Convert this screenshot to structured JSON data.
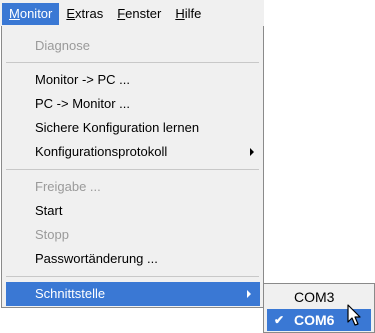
{
  "menubar": {
    "items": [
      {
        "label": "Monitor",
        "mnemonic": "M",
        "rest": "onitor",
        "active": true
      },
      {
        "label": "Extras",
        "mnemonic": "E",
        "rest": "xtras"
      },
      {
        "label": "Fenster",
        "mnemonic": "F",
        "rest": "enster"
      },
      {
        "label": "Hilfe",
        "mnemonic": "H",
        "rest": "ilfe"
      }
    ]
  },
  "menu": {
    "items": [
      {
        "label": "Diagnose",
        "disabled": true
      },
      {
        "label": "Monitor -> PC ..."
      },
      {
        "label": "PC -> Monitor ..."
      },
      {
        "label": "Sichere Konfiguration lernen"
      },
      {
        "label": "Konfigurationsprotokoll",
        "has_submenu": true
      },
      {
        "label": "Freigabe ...",
        "disabled": true
      },
      {
        "label": "Start"
      },
      {
        "label": "Stopp",
        "disabled": true
      },
      {
        "label": "Passwortänderung ..."
      },
      {
        "label": "Schnittstelle",
        "has_submenu": true,
        "highlighted": true
      }
    ]
  },
  "submenu": {
    "items": [
      {
        "label": "COM3"
      },
      {
        "label": "COM6",
        "checked": true,
        "highlighted": true
      }
    ],
    "check_glyph": "✔"
  },
  "colors": {
    "highlight": "#3a78d4",
    "menu_bg": "#f0f0f0",
    "disabled_text": "#9a9a9a"
  }
}
